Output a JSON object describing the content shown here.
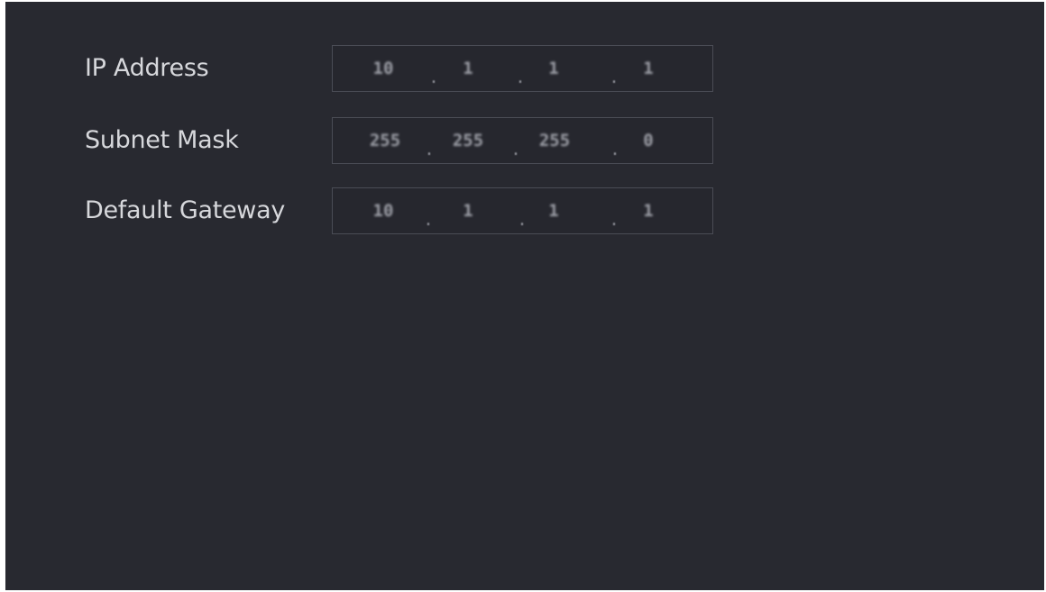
{
  "form": {
    "fields": [
      {
        "label": "IP Address",
        "octets": [
          "10",
          "1",
          "1",
          "1"
        ]
      },
      {
        "label": "Subnet Mask",
        "octets": [
          "255",
          "255",
          "255",
          "0"
        ]
      },
      {
        "label": "Default Gateway",
        "octets": [
          "10",
          "1",
          "1",
          "1"
        ]
      }
    ],
    "separator": "."
  }
}
